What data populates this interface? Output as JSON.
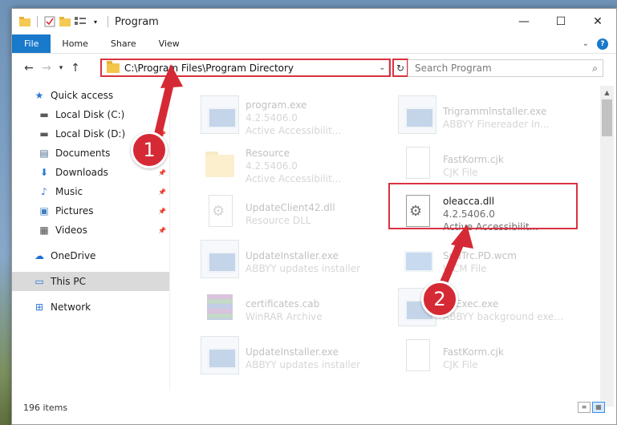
{
  "window": {
    "title": "Program",
    "controls": {
      "minimize": "—",
      "maximize": "☐",
      "close": "✕"
    }
  },
  "ribbon": {
    "tabs": [
      "File",
      "Home",
      "Share",
      "View"
    ],
    "chevron": "⌄"
  },
  "address": {
    "path": "C:\\Program Files\\Program Directory",
    "search_placeholder": "Search Program"
  },
  "sidebar": {
    "items": [
      {
        "label": "Quick access",
        "icon": "star-icon",
        "glyph": "★",
        "color": "#2b78d4",
        "pinned": false
      },
      {
        "label": "Local Disk (C:)",
        "icon": "drive-icon",
        "glyph": "▬",
        "color": "#5a5a5a",
        "pinned": true
      },
      {
        "label": "Local Disk (D:)",
        "icon": "drive-icon",
        "glyph": "▬",
        "color": "#5a5a5a",
        "pinned": true
      },
      {
        "label": "Documents",
        "icon": "documents-icon",
        "glyph": "▤",
        "color": "#4a6a8a",
        "pinned": true
      },
      {
        "label": "Downloads",
        "icon": "download-icon",
        "glyph": "⬇",
        "color": "#2b78d4",
        "pinned": true
      },
      {
        "label": "Music",
        "icon": "music-icon",
        "glyph": "♪",
        "color": "#2b78d4",
        "pinned": true
      },
      {
        "label": "Pictures",
        "icon": "pictures-icon",
        "glyph": "▣",
        "color": "#3f7fbf",
        "pinned": true
      },
      {
        "label": "Videos",
        "icon": "videos-icon",
        "glyph": "▦",
        "color": "#4a4a4a",
        "pinned": true
      },
      {
        "label": "OneDrive",
        "icon": "cloud-icon",
        "glyph": "☁",
        "color": "#1f6fcf",
        "pinned": false
      },
      {
        "label": "This PC",
        "icon": "computer-icon",
        "glyph": "▭",
        "color": "#2b78d4",
        "pinned": false
      },
      {
        "label": "Network",
        "icon": "network-icon",
        "glyph": "⊞",
        "color": "#2b78d4",
        "pinned": false
      }
    ]
  },
  "files": [
    {
      "name": "program.exe",
      "line2": "4.2.5406.0",
      "line3": "Active Accessibilit...",
      "icon": "exe"
    },
    {
      "name": "Trigrammlnstaller.exe",
      "line2": "ABBYY Finereader In...",
      "line3": "",
      "icon": "exe"
    },
    {
      "name": "Resource",
      "line2": "4.2.5406.0",
      "line3": "Active Accessibilit...",
      "icon": "folder"
    },
    {
      "name": "FastKorm.cjk",
      "line2": "CJK File",
      "line3": "",
      "icon": "doc"
    },
    {
      "name": "UpdateClient42.dll",
      "line2": "Resource DLL",
      "line3": "",
      "icon": "gear"
    },
    {
      "name": "oleacca.dll",
      "line2": "4.2.5406.0",
      "line3": "Active Accessibilit...",
      "icon": "gear"
    },
    {
      "name": "UpdateInstaller.exe",
      "line2": "ABBYY updates installer",
      "line3": "",
      "icon": "exe"
    },
    {
      "name": "SndTrc.PD.wcm",
      "line2": "WCM File",
      "line3": "",
      "icon": "wcm"
    },
    {
      "name": "certificates.cab",
      "line2": "WinRAR Archive",
      "line3": "",
      "icon": "rar"
    },
    {
      "name": "BgExec.exe",
      "line2": "ABBYY background exe...",
      "line3": "",
      "icon": "exe"
    },
    {
      "name": "UpdateInstaller.exe",
      "line2": "ABBYY updates installer",
      "line3": "",
      "icon": "exe"
    },
    {
      "name": "FastKorm.cjk",
      "line2": "CJK File",
      "line3": "",
      "icon": "doc"
    }
  ],
  "status": {
    "item_count": "196 items"
  },
  "annotations": {
    "badge1": "1",
    "badge2": "2",
    "color": "#d9323f"
  }
}
